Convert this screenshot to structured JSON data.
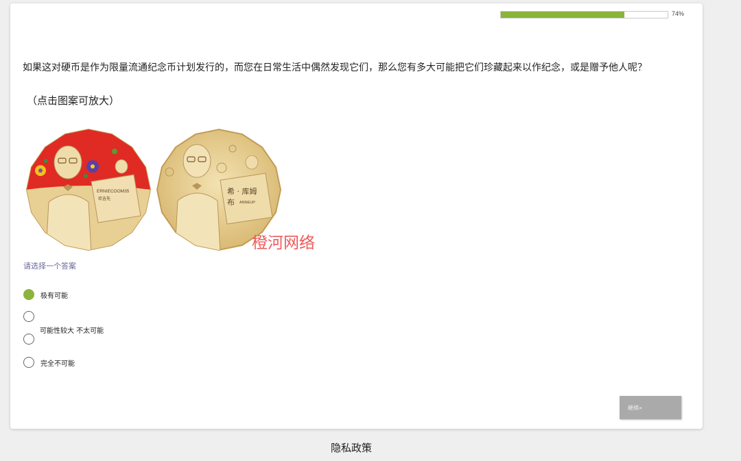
{
  "progress": {
    "percent_label": "74%",
    "value": 0.74,
    "color": "#8ab43c"
  },
  "question": {
    "text": "如果这对硬币是作为限量流通纪念币计划发行的，而您在日常生活中偶然发现它们，那么您有多大可能把它们珍藏起来以作纪念，或是赠予他人呢？",
    "hint": "（点击图案可放大）"
  },
  "coins": {
    "left": {
      "name_text": "ERNIECOOM35",
      "sub_text": "欢吉先"
    },
    "right": {
      "name_line1": "希 · 库姆",
      "name_line2": "布",
      "sub_text": "ANNEUP"
    }
  },
  "watermark": "橙河网络",
  "instruction": "请选择一个答案",
  "options": [
    {
      "label": "极有可能",
      "checked": true
    },
    {
      "label": "",
      "checked": false
    },
    {
      "label": "可能性较大 不太可能",
      "checked": false
    },
    {
      "label": "完全不可能",
      "checked": false
    }
  ],
  "continue_label": "继续»",
  "privacy_label": "隐私政策"
}
